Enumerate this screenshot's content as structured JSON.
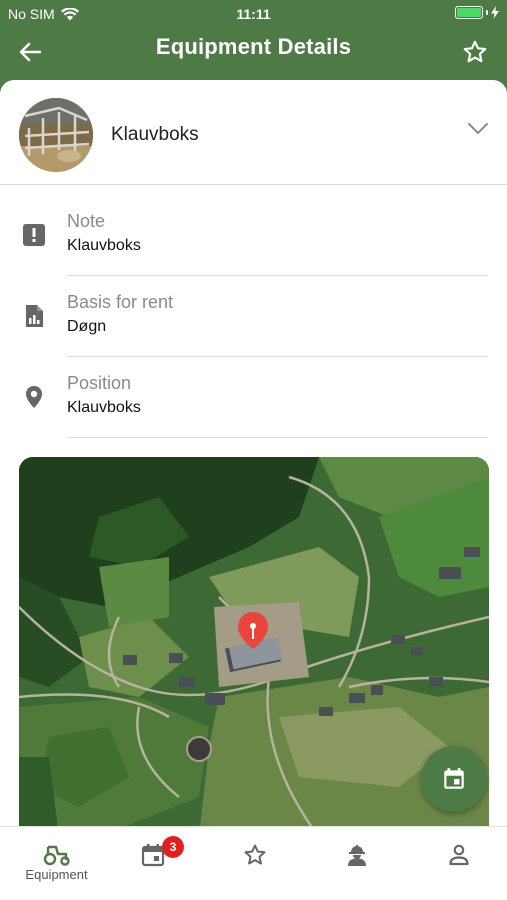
{
  "status_bar": {
    "carrier": "No SIM",
    "time": "11:11",
    "battery_level": 1.0
  },
  "header": {
    "title": "Equipment Details",
    "back_icon": "arrow-left-icon",
    "favorite_icon": "star-outline-icon"
  },
  "equipment": {
    "name": "Klauvboks",
    "expand_icon": "chevron-down-icon"
  },
  "details": [
    {
      "icon": "alert-box-icon",
      "label": "Note",
      "value": "Klauvboks"
    },
    {
      "icon": "report-file-icon",
      "label": "Basis for rent",
      "value": "Døgn"
    },
    {
      "icon": "location-pin-icon",
      "label": "Position",
      "value": "Klauvboks"
    }
  ],
  "map": {
    "type": "satellite",
    "marker_color": "#e8453c",
    "fab_icon": "calendar-icon"
  },
  "tabbar": {
    "active_color": "#4e7a46",
    "tabs": [
      {
        "icon": "tractor-icon",
        "label": "Equipment",
        "active": true
      },
      {
        "icon": "calendar-icon",
        "label": "",
        "badge": "3"
      },
      {
        "icon": "star-outline-icon",
        "label": ""
      },
      {
        "icon": "worker-icon",
        "label": ""
      },
      {
        "icon": "person-icon",
        "label": ""
      }
    ]
  },
  "colors": {
    "primary": "#4e7a46",
    "badge": "#e02020"
  }
}
